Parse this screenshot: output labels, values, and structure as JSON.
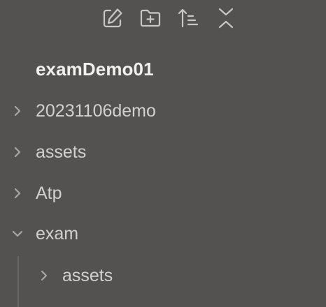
{
  "toolbar": {
    "buttons": [
      {
        "name": "new-note",
        "icon": "edit-note-icon"
      },
      {
        "name": "new-folder",
        "icon": "folder-plus-icon"
      },
      {
        "name": "sort",
        "icon": "sort-icon"
      },
      {
        "name": "collapse-all",
        "icon": "collapse-all-icon"
      }
    ]
  },
  "vault": {
    "title": "examDemo01"
  },
  "tree": {
    "items": [
      {
        "label": "20231106demo",
        "expanded": false,
        "depth": 0
      },
      {
        "label": "assets",
        "expanded": false,
        "depth": 0
      },
      {
        "label": "Atp",
        "expanded": false,
        "depth": 0
      },
      {
        "label": "exam",
        "expanded": true,
        "depth": 0
      },
      {
        "label": "assets",
        "expanded": false,
        "depth": 1
      }
    ]
  },
  "colors": {
    "background": "#545251",
    "title": "#f2f0ed",
    "text": "#d3d1ce",
    "icon": "#c9c7c4"
  }
}
